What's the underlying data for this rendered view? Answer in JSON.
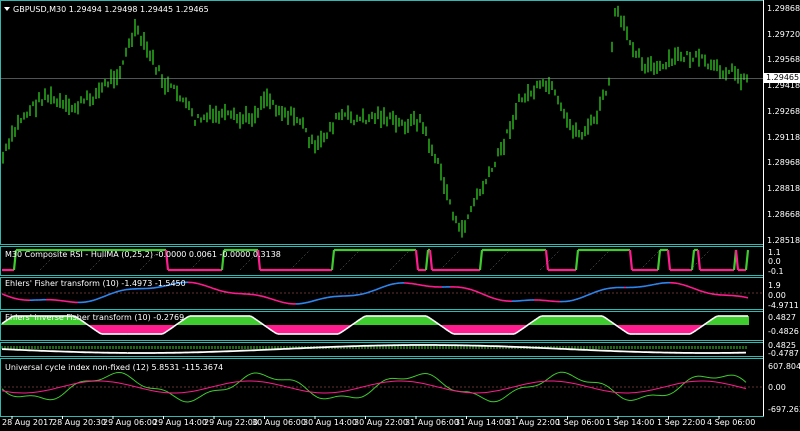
{
  "main": {
    "symbol_title": "GBPUSD,M30",
    "ohlc": "1.29494 1.29498 1.29445 1.29465",
    "current_price": "1.29465",
    "price_labels": [
      "1.29868",
      "1.29720",
      "1.29568",
      "1.29418",
      "1.29268",
      "1.29118",
      "1.28968",
      "1.28818",
      "1.28668",
      "1.28518"
    ]
  },
  "panes": [
    {
      "title": "M30 Composite RSI - HullMA (0,25,2) -0.0000 0.0061 -0.0000 0.3138",
      "labels": [
        "1.1",
        "0.0",
        "-0.1"
      ]
    },
    {
      "title": "Ehlers' Fisher transform (10) -1.4973 -1.5450",
      "labels": [
        "1.9",
        "0.00",
        "-4.9711"
      ]
    },
    {
      "title": "Ehlers' inverse Fisher transform (10) -0.2769",
      "labels": [
        "0.4827",
        "-0.4826"
      ]
    },
    {
      "title": "",
      "labels": [
        "0.4825",
        "-0.4787"
      ]
    },
    {
      "title": "Universal cycle index non-fixed (12) 5.8531 -115.3674",
      "labels": [
        "607.8040",
        "0.00",
        "-697.2638"
      ]
    }
  ],
  "time_labels": [
    "28 Aug 2017",
    "28 Aug 20:30",
    "29 Aug 06:00",
    "29 Aug 14:00",
    "29 Aug 22:00",
    "30 Aug 06:00",
    "30 Aug 14:00",
    "30 Aug 22:00",
    "31 Aug 06:00",
    "31 Aug 14:00",
    "31 Aug 22:00",
    "1 Sep 06:00",
    "1 Sep 14:00",
    "1 Sep 22:00",
    "4 Sep 06:00"
  ],
  "colors": {
    "background": "#000000",
    "candle": "#2ECC1E",
    "frame": "#2FB9B0",
    "magenta": "#FF1C8E",
    "blue": "#2F86F0",
    "green": "#3FCC2E",
    "white": "#FFFFFF",
    "level_line": "#C86464"
  }
}
